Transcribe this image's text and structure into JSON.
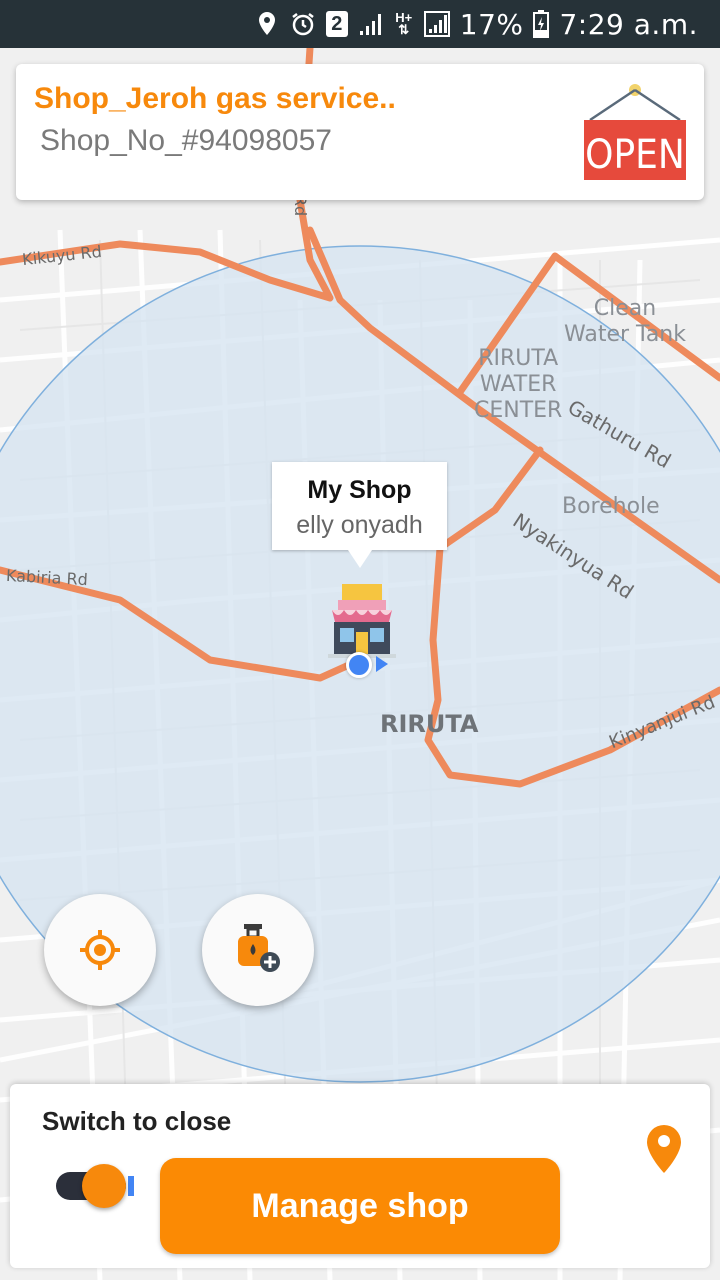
{
  "status_bar": {
    "battery": "17%",
    "time": "7:29 a.m.",
    "sim_slot": "2",
    "network_type": "H+",
    "icons": [
      "location-icon",
      "alarm-icon",
      "sim-icon",
      "signal-icon",
      "network-icon",
      "signal-icon",
      "battery-charging-icon"
    ]
  },
  "shop_card": {
    "name": "Shop_Jeroh gas service..",
    "number": "Shop_No_#94098057",
    "sign_text": "OPEN",
    "accent_color": "#f7890c"
  },
  "map": {
    "area_label": "RIRUTA",
    "places": [
      {
        "text": "Clean\nWater Tank"
      },
      {
        "text": "RIRUTA\nWATER\nCENTER"
      },
      {
        "text": "Borehole"
      }
    ],
    "roads": [
      "Kikuyu Rd",
      "Kabiria Rd",
      "Gathuru Rd",
      "Nyakinyua Rd",
      "Kinyanjui Rd",
      "Rd"
    ],
    "road_color": "#f08a5d",
    "radius_fill": "#d9e6f2"
  },
  "marker": {
    "title": "My Shop",
    "subtitle": "elly onyadh"
  },
  "buttons": {
    "locate_icon": "crosshair-icon",
    "add_gas_icon": "gas-cylinder-add-icon"
  },
  "bottom_panel": {
    "switch_label": "Switch to close",
    "switch_on": true,
    "manage_label": "Manage shop",
    "pin_icon": "location-pin-icon"
  }
}
